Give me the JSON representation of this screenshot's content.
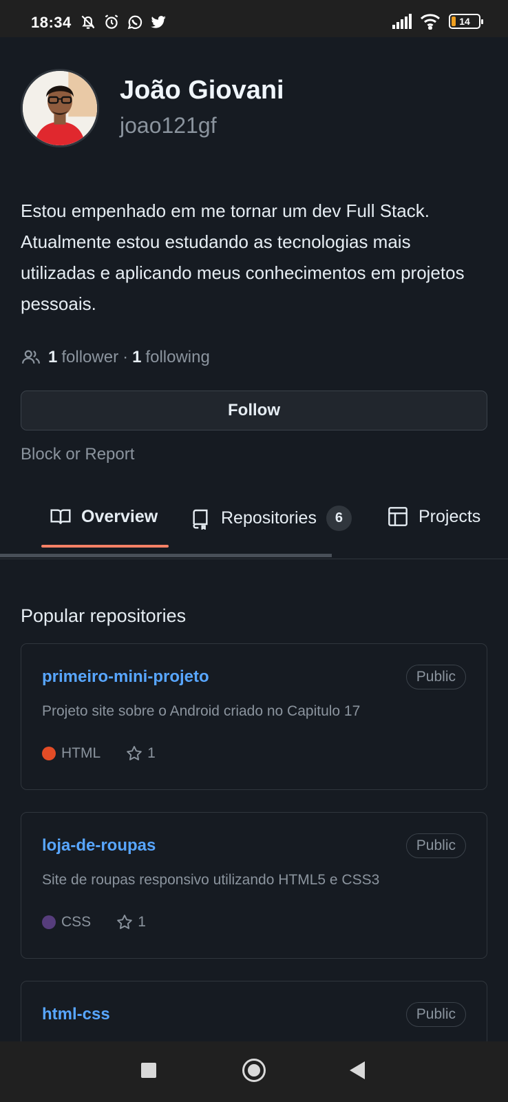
{
  "status_bar": {
    "time": "18:34",
    "icons_left": [
      "mute-icon",
      "alarm-icon",
      "whatsapp-icon",
      "twitter-icon"
    ],
    "icons_right": [
      "signal-icon",
      "wifi-icon",
      "battery-icon"
    ],
    "battery_level": "14",
    "battery_fraction": 0.14
  },
  "profile": {
    "name": "João Giovani",
    "login": "joao121gf",
    "bio": "Estou empenhado em me tornar um dev Full Stack. Atualmente estou estudando as tecnologias mais utilizadas e aplicando meus conhecimentos em projetos pessoais.",
    "followers_count": "1",
    "followers_label": "follower",
    "separator": "·",
    "following_count": "1",
    "following_label": "following",
    "follow_button": "Follow",
    "block_report": "Block or Report"
  },
  "tabs": [
    {
      "label": "Overview",
      "icon": "book-icon",
      "selected": true
    },
    {
      "label": "Repositories",
      "icon": "repo-icon",
      "count": "6"
    },
    {
      "label": "Projects",
      "icon": "table-icon"
    }
  ],
  "popular": {
    "title": "Popular repositories",
    "repos": [
      {
        "name": "primeiro-mini-projeto",
        "visibility": "Public",
        "description": "Projeto site sobre o Android criado no Capitulo 17",
        "language": "HTML",
        "language_color": "#e34c26",
        "stars": "1"
      },
      {
        "name": "loja-de-roupas",
        "visibility": "Public",
        "description": "Site de roupas responsivo utilizando HTML5 e CSS3",
        "language": "CSS",
        "language_color": "#563d7c",
        "stars": "1"
      },
      {
        "name": "html-css",
        "visibility": "Public"
      }
    ]
  },
  "nav_bar": {
    "buttons": [
      "recents-button",
      "home-button",
      "back-button"
    ]
  },
  "colors": {
    "background": "#161b22",
    "link": "#58a6ff",
    "tab_underline": "#f78166",
    "muted_text": "#8b949e"
  }
}
